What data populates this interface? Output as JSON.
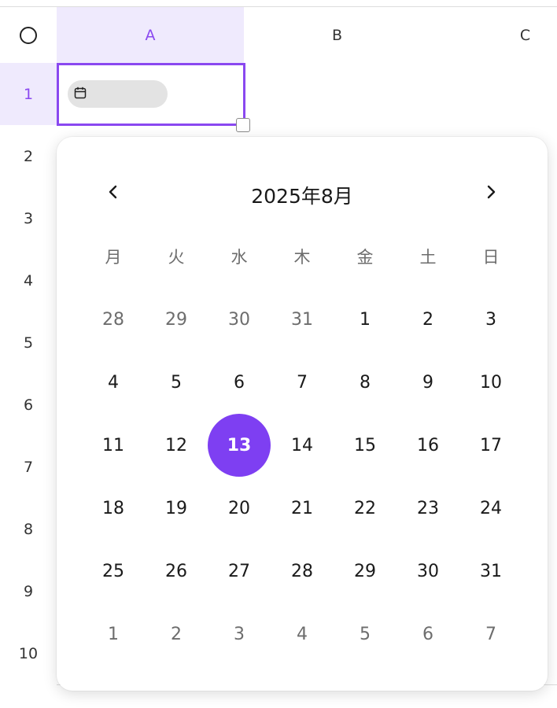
{
  "columns": [
    {
      "label": "A",
      "selected": true
    },
    {
      "label": "B",
      "selected": false
    },
    {
      "label": "C",
      "selected": false
    }
  ],
  "rows": [
    {
      "label": "1",
      "selected": true
    },
    {
      "label": "2",
      "selected": false
    },
    {
      "label": "3",
      "selected": false
    },
    {
      "label": "4",
      "selected": false
    },
    {
      "label": "5",
      "selected": false
    },
    {
      "label": "6",
      "selected": false
    },
    {
      "label": "7",
      "selected": false
    },
    {
      "label": "8",
      "selected": false
    },
    {
      "label": "9",
      "selected": false
    },
    {
      "label": "10",
      "selected": false
    }
  ],
  "date_cell": {
    "icon": "calendar-icon"
  },
  "colors": {
    "accent": "#7e3ff2",
    "header_selected_bg": "#efeafd",
    "header_selected_text": "#8a48f0"
  },
  "calendar": {
    "title": "2025年8月",
    "prev_icon": "chevron-left-icon",
    "next_icon": "chevron-right-icon",
    "weekdays": [
      "月",
      "火",
      "水",
      "木",
      "金",
      "土",
      "日"
    ],
    "weeks": [
      [
        {
          "d": "28",
          "other": true
        },
        {
          "d": "29",
          "other": true
        },
        {
          "d": "30",
          "other": true
        },
        {
          "d": "31",
          "other": true
        },
        {
          "d": "1"
        },
        {
          "d": "2"
        },
        {
          "d": "3"
        }
      ],
      [
        {
          "d": "4"
        },
        {
          "d": "5"
        },
        {
          "d": "6"
        },
        {
          "d": "7"
        },
        {
          "d": "8"
        },
        {
          "d": "9"
        },
        {
          "d": "10"
        }
      ],
      [
        {
          "d": "11"
        },
        {
          "d": "12"
        },
        {
          "d": "13",
          "selected": true
        },
        {
          "d": "14"
        },
        {
          "d": "15"
        },
        {
          "d": "16"
        },
        {
          "d": "17"
        }
      ],
      [
        {
          "d": "18"
        },
        {
          "d": "19"
        },
        {
          "d": "20"
        },
        {
          "d": "21"
        },
        {
          "d": "22"
        },
        {
          "d": "23"
        },
        {
          "d": "24"
        }
      ],
      [
        {
          "d": "25"
        },
        {
          "d": "26"
        },
        {
          "d": "27"
        },
        {
          "d": "28"
        },
        {
          "d": "29"
        },
        {
          "d": "30"
        },
        {
          "d": "31"
        }
      ],
      [
        {
          "d": "1",
          "other": true
        },
        {
          "d": "2",
          "other": true
        },
        {
          "d": "3",
          "other": true
        },
        {
          "d": "4",
          "other": true
        },
        {
          "d": "5",
          "other": true
        },
        {
          "d": "6",
          "other": true
        },
        {
          "d": "7",
          "other": true
        }
      ]
    ]
  }
}
